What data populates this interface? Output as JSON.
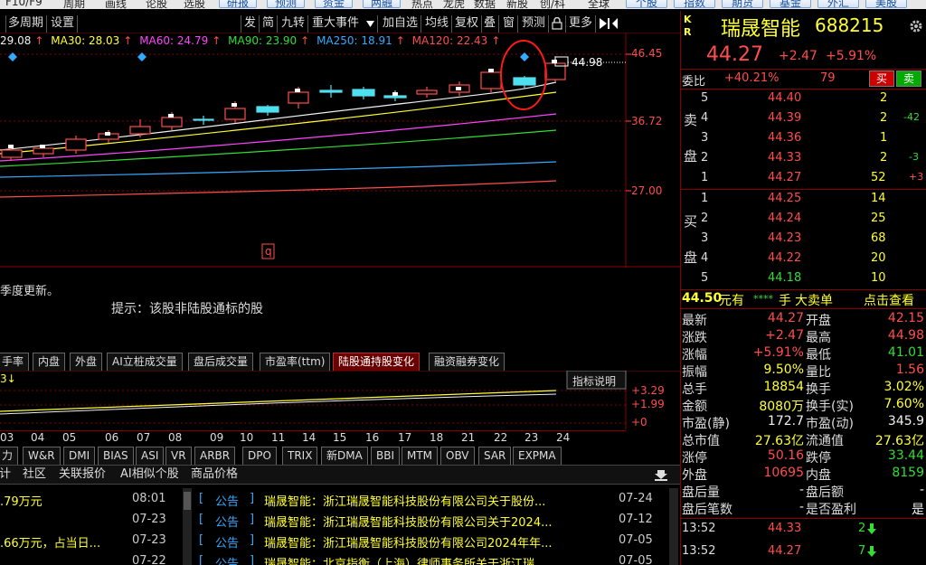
{
  "top_menu": {
    "left": [
      "F10/F9",
      "周期",
      "画线",
      "论股",
      "选股"
    ],
    "mid_buttons": [
      "研报",
      "预测",
      "资金",
      "两融"
    ],
    "mid_labels": [
      "热点",
      "龙虎",
      "数据",
      "新股",
      "创/科",
      "全球"
    ],
    "right_buttons": [
      "个股",
      "指数",
      "期货",
      "基金",
      "外汇",
      "美股"
    ]
  },
  "chart_toolbar": {
    "left": [
      "多周期",
      "设置"
    ],
    "right": [
      "发",
      "简",
      "九转",
      "重大事件",
      "加自选",
      "均线",
      "复权",
      "叠",
      "窗",
      "预测",
      "更多"
    ],
    "dropdown_icon": "triangle-down-icon",
    "lock_icon": "lock-icon",
    "arrows_icon": "play-arrows-icon"
  },
  "ma_bar": [
    {
      "label": "29.08",
      "color": "#f0f0f0"
    },
    {
      "label": "MA30: 28.03",
      "color": "#ffff33"
    },
    {
      "label": "MA60: 24.79",
      "color": "#ff44ff"
    },
    {
      "label": "MA90: 23.90",
      "color": "#33dd33"
    },
    {
      "label": "MA250: 18.91",
      "color": "#33aaff"
    },
    {
      "label": "MA120: 22.43",
      "color": "#ff4d4d"
    }
  ],
  "price_axis": [
    "46.45",
    "36.72",
    "27.00"
  ],
  "last_price_tag": "44.98",
  "q_marker": "q",
  "info_text": "季度更新。",
  "hint_text": "提示：该股非陆股通标的股",
  "indicator_tabs": {
    "items": [
      "手率",
      "内盘",
      "外盘",
      "AI立桩成交量",
      "盘后成交量",
      "市盈率(ttm)",
      "陆股通持股变化",
      "融资融券变化"
    ],
    "active": "陆股通持股变化"
  },
  "indicator_panel": {
    "explain_btn": "指标说明",
    "axis": [
      "+3.29",
      "+1.99",
      "+0"
    ],
    "left_marker": "3↓"
  },
  "date_axis": [
    "03",
    "04",
    "05",
    "06",
    "07",
    "08",
    "09",
    "10",
    "11",
    "14",
    "15",
    "16",
    "17",
    "18",
    "21",
    "22",
    "23",
    "24"
  ],
  "indicator_list": [
    "力",
    "W&R",
    "DMI",
    "BIAS",
    "ASI",
    "VR",
    "ARBR",
    "DPO",
    "TRIX",
    "新DMA",
    "BBI",
    "MTM",
    "OBV",
    "SAR",
    "EXPMA"
  ],
  "news_tabs": [
    "计",
    "社区",
    "关联报价",
    "AI相似个股",
    "商品价格"
  ],
  "news_left": [
    {
      "text": ".79万元",
      "time": "08:01"
    },
    {
      "text": "",
      "time": "07-23"
    },
    {
      "text": ".66万元，占当日...",
      "time": "07-23"
    },
    {
      "text": "",
      "time": "07-22"
    }
  ],
  "news_right": [
    {
      "tag": "公告",
      "text": "瑞晟智能：浙江瑞晟智能科技股份有限公司关于股份...",
      "time": "07-24"
    },
    {
      "tag": "公告",
      "text": "瑞晟智能：浙江瑞晟智能科技股份有限公司关于2024...",
      "time": "07-12"
    },
    {
      "tag": "公告",
      "text": "瑞晟智能：浙江瑞晟智能科技股份有限公司2024年年...",
      "time": "07-05"
    },
    {
      "tag": "公告",
      "text": "瑞晟智能：北京指衡（上海）律师事务所关于浙江瑞...",
      "time": "07-05"
    }
  ],
  "stock": {
    "kr": [
      "K",
      "R"
    ],
    "name": "瑞晟智能",
    "code": "688215",
    "price": "44.27",
    "change": "+2.47",
    "pct": "+5.91%",
    "weibi_label": "委比",
    "weibi": "+40.21%",
    "weicha": "79",
    "buy_btn": "买",
    "sell_btn": "卖",
    "sell_label": [
      "卖",
      "盘"
    ],
    "buy_label": [
      "买",
      "盘"
    ],
    "asks": [
      {
        "lv": "5",
        "price": "44.40",
        "vol": "2",
        "chg": ""
      },
      {
        "lv": "4",
        "price": "44.39",
        "vol": "2",
        "chg": "-42"
      },
      {
        "lv": "3",
        "price": "44.36",
        "vol": "1",
        "chg": ""
      },
      {
        "lv": "2",
        "price": "44.33",
        "vol": "2",
        "chg": "-3"
      },
      {
        "lv": "1",
        "price": "44.27",
        "vol": "52",
        "chg": "+3"
      }
    ],
    "bids": [
      {
        "lv": "1",
        "price": "44.25",
        "vol": "14",
        "chg": ""
      },
      {
        "lv": "2",
        "price": "44.24",
        "vol": "25",
        "chg": ""
      },
      {
        "lv": "3",
        "price": "44.23",
        "vol": "68",
        "chg": ""
      },
      {
        "lv": "4",
        "price": "44.22",
        "vol": "20",
        "chg": ""
      },
      {
        "lv": "5",
        "price": "44.18",
        "vol": "10",
        "chg": ""
      }
    ],
    "big_order": {
      "price": "44.50",
      "unit": "元有",
      "hidden": "****",
      "hand": "手",
      "type": "大卖单",
      "action": "点击查看"
    },
    "stats": [
      {
        "l1": "最新",
        "v1": "44.27",
        "c1": "up",
        "l2": "开盘",
        "v2": "42.15",
        "c2": "up"
      },
      {
        "l1": "涨跌",
        "v1": "+2.47",
        "c1": "up",
        "l2": "最高",
        "v2": "44.98",
        "c2": "up"
      },
      {
        "l1": "涨幅",
        "v1": "+5.91%",
        "c1": "up",
        "l2": "最低",
        "v2": "41.01",
        "c2": "dn"
      },
      {
        "l1": "振幅",
        "v1": "9.50%",
        "c1": "yl",
        "l2": "量比",
        "v2": "1.56",
        "c2": "up"
      },
      {
        "l1": "总手",
        "v1": "18854",
        "c1": "yl",
        "l2": "换手",
        "v2": "3.02%",
        "c2": "yl"
      },
      {
        "l1": "金额",
        "v1": "8080万",
        "c1": "yl",
        "l2": "换手(实)",
        "v2": "7.60%",
        "c2": "yl"
      },
      {
        "l1": "市盈(静)",
        "v1": "172.7",
        "c1": "wh",
        "l2": "市盈(动)",
        "v2": "345.9",
        "c2": "wh"
      },
      {
        "l1": "总市值",
        "v1": "27.63亿",
        "c1": "yl",
        "l2": "流通值",
        "v2": "27.63亿",
        "c2": "yl"
      },
      {
        "l1": "涨停",
        "v1": "50.16",
        "c1": "up",
        "l2": "跌停",
        "v2": "33.44",
        "c2": "dn"
      },
      {
        "l1": "外盘",
        "v1": "10695",
        "c1": "up",
        "l2": "内盘",
        "v2": "8159",
        "c2": "dn"
      },
      {
        "l1": "盘后量",
        "v1": "-",
        "c1": "wh",
        "l2": "盘后额",
        "v2": "-",
        "c2": "wh"
      },
      {
        "l1": "盘后笔数",
        "v1": "-",
        "c1": "wh",
        "l2": "是否盈利",
        "v2": "是",
        "c2": "wh"
      }
    ],
    "ticks": [
      {
        "time": "13:52",
        "price": "44.33",
        "vol": "2",
        "dir": "down"
      },
      {
        "time": "13:52",
        "price": "44.27",
        "vol": "7",
        "dir": "down"
      }
    ]
  },
  "colors": {
    "up": "#ff4d4d",
    "down": "#33dd33",
    "yellow": "#ffff33",
    "panel_border": "#8a0000"
  }
}
